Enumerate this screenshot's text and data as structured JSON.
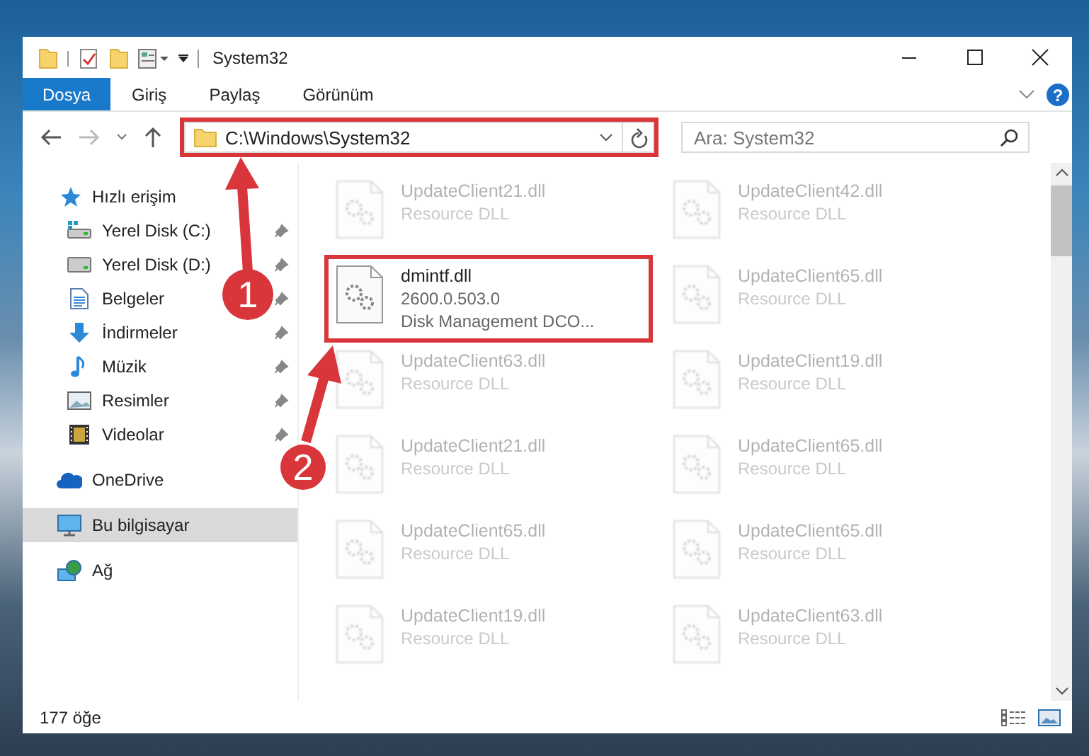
{
  "window": {
    "title": "System32"
  },
  "ribbon_tabs": [
    {
      "label": "Dosya",
      "selected": true
    },
    {
      "label": "Giriş",
      "selected": false
    },
    {
      "label": "Paylaş",
      "selected": false
    },
    {
      "label": "Görünüm",
      "selected": false
    }
  ],
  "address": {
    "path": "C:\\Windows\\System32"
  },
  "search": {
    "placeholder": "Ara: System32"
  },
  "help": {
    "label": "?"
  },
  "nav": [
    {
      "label": "Hızlı erişim",
      "kind": "star",
      "selected": false,
      "children": [
        {
          "label": "Yerel Disk (C:)",
          "kind": "system-drive",
          "pinned": true
        },
        {
          "label": "Yerel Disk (D:)",
          "kind": "drive",
          "pinned": true
        },
        {
          "label": "Belgeler",
          "kind": "document",
          "pinned": true
        },
        {
          "label": "İndirmeler",
          "kind": "download",
          "pinned": true
        },
        {
          "label": "Müzik",
          "kind": "music",
          "pinned": true
        },
        {
          "label": "Resimler",
          "kind": "picture",
          "pinned": true
        },
        {
          "label": "Videolar",
          "kind": "video",
          "pinned": true
        }
      ]
    },
    {
      "label": "OneDrive",
      "kind": "cloud",
      "selected": false
    },
    {
      "label": "Bu bilgisayar",
      "kind": "computer",
      "selected": true
    },
    {
      "label": "Ağ",
      "kind": "network",
      "selected": false
    }
  ],
  "files": [
    {
      "name": "UpdateClient21.dll",
      "lines": [
        "Resource DLL"
      ],
      "selected": false
    },
    {
      "name": "UpdateClient42.dll",
      "lines": [
        "Resource DLL"
      ],
      "selected": false
    },
    {
      "name": "dmintf.dll",
      "lines": [
        "2600.0.503.0",
        "Disk Management DCO..."
      ],
      "selected": true
    },
    {
      "name": "UpdateClient65.dll",
      "lines": [
        "Resource DLL"
      ],
      "selected": false
    },
    {
      "name": "UpdateClient63.dll",
      "lines": [
        "Resource DLL"
      ],
      "selected": false
    },
    {
      "name": "UpdateClient19.dll",
      "lines": [
        "Resource DLL"
      ],
      "selected": false
    },
    {
      "name": "UpdateClient21.dll",
      "lines": [
        "Resource DLL"
      ],
      "selected": false
    },
    {
      "name": "UpdateClient65.dll",
      "lines": [
        "Resource DLL"
      ],
      "selected": false
    },
    {
      "name": "UpdateClient65.dll",
      "lines": [
        "Resource DLL"
      ],
      "selected": false
    },
    {
      "name": "UpdateClient65.dll",
      "lines": [
        "Resource DLL"
      ],
      "selected": false
    },
    {
      "name": "UpdateClient19.dll",
      "lines": [
        "Resource DLL"
      ],
      "selected": false
    },
    {
      "name": "UpdateClient63.dll",
      "lines": [
        "Resource DLL"
      ],
      "selected": false
    }
  ],
  "status_bar": {
    "count": "177 öğe"
  },
  "annotations": [
    {
      "number": "1"
    },
    {
      "number": "2"
    }
  ]
}
